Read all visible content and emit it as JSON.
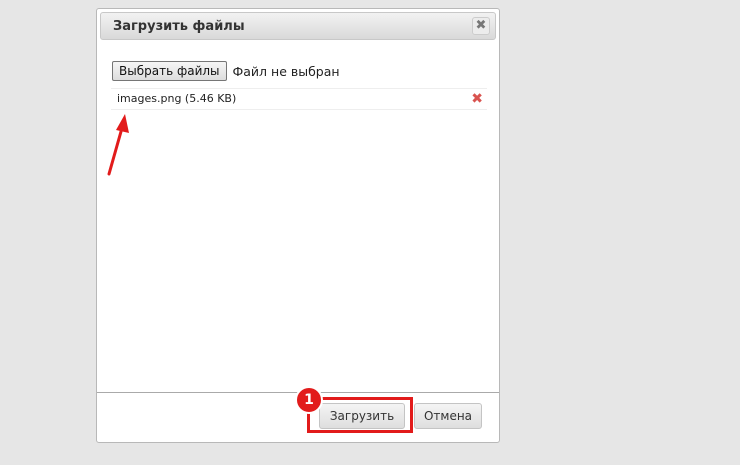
{
  "dialog": {
    "title": "Загрузить файлы",
    "close_glyph": "✖"
  },
  "file_input": {
    "choose_label": "Выбрать файлы",
    "status_text": "Файл не выбран"
  },
  "files": [
    {
      "name": "images.png (5.46 KB)",
      "remove_glyph": "✖"
    }
  ],
  "footer": {
    "upload_label": "Загрузить",
    "cancel_label": "Отмена"
  },
  "annotation": {
    "step_number": "1",
    "color": "#e21b1b"
  }
}
